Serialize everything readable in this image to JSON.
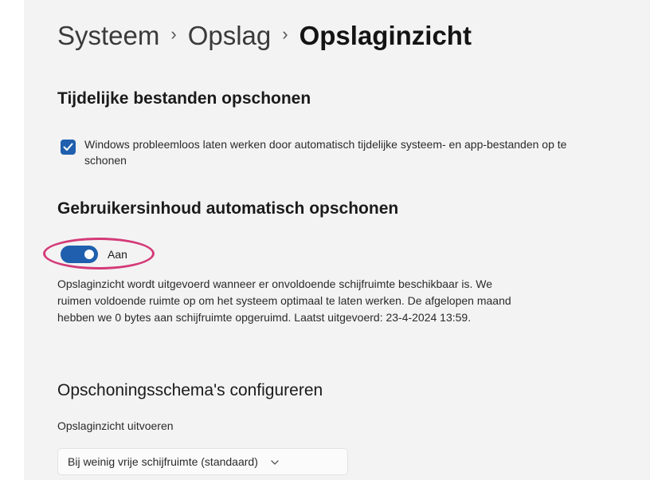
{
  "breadcrumb": {
    "items": [
      "Systeem",
      "Opslag"
    ],
    "separator": "›",
    "current": "Opslaginzicht"
  },
  "temp_files": {
    "heading": "Tijdelijke bestanden opschonen",
    "checkbox_label": "Windows probleemloos laten werken door automatisch tijdelijke systeem- en app-bestanden op te schonen",
    "checked": true
  },
  "user_content": {
    "heading": "Gebruikersinhoud automatisch opschonen",
    "toggle_label": "Aan",
    "toggle_on": true,
    "description": "Opslaginzicht wordt uitgevoerd wanneer er onvoldoende schijfruimte beschikbaar is. We ruimen voldoende ruimte op om het systeem optimaal te laten werken. De afgelopen maand hebben we 0 bytes aan schijfruimte opgeruimd. Laatst uitgevoerd: 23-4-2024 13:59."
  },
  "schedule": {
    "heading": "Opschoningsschema's configureren",
    "field_label": "Opslaginzicht uitvoeren",
    "dropdown_value": "Bij weinig vrije schijfruimte (standaard)"
  },
  "colors": {
    "accent": "#1f5fae",
    "highlight_ring": "#d43a78"
  },
  "icons": {
    "checkbox": "checkmark-icon",
    "dropdown": "chevron-down-icon"
  }
}
